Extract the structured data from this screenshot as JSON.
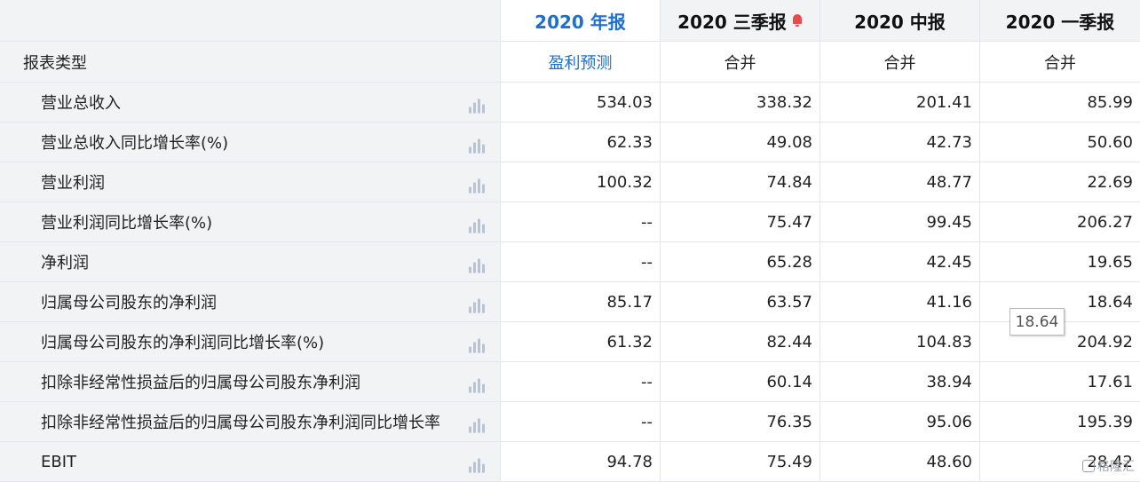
{
  "columns": [
    {
      "label": "2020 年报",
      "active": true
    },
    {
      "label": "2020 三季报",
      "bell": true
    },
    {
      "label": "2020 中报"
    },
    {
      "label": "2020 一季报"
    }
  ],
  "report_type": {
    "label": "报表类型",
    "values": [
      "盈利预测",
      "合并",
      "合并",
      "合并"
    ]
  },
  "rows": [
    {
      "label": "营业总收入",
      "values": [
        "534.03",
        "338.32",
        "201.41",
        "85.99"
      ]
    },
    {
      "label": "营业总收入同比增长率(%)",
      "values": [
        "62.33",
        "49.08",
        "42.73",
        "50.60"
      ]
    },
    {
      "label": "营业利润",
      "values": [
        "100.32",
        "74.84",
        "48.77",
        "22.69"
      ]
    },
    {
      "label": "营业利润同比增长率(%)",
      "values": [
        "--",
        "75.47",
        "99.45",
        "206.27"
      ]
    },
    {
      "label": "净利润",
      "values": [
        "--",
        "65.28",
        "42.45",
        "19.65"
      ]
    },
    {
      "label": "归属母公司股东的净利润",
      "values": [
        "85.17",
        "63.57",
        "41.16",
        "18.64"
      ]
    },
    {
      "label": "归属母公司股东的净利润同比增长率(%)",
      "values": [
        "61.32",
        "82.44",
        "104.83",
        "204.92"
      ]
    },
    {
      "label": "扣除非经常性损益后的归属母公司股东净利润",
      "values": [
        "--",
        "60.14",
        "38.94",
        "17.61"
      ]
    },
    {
      "label": "扣除非经常性损益后的归属母公司股东净利润同比增长率",
      "values": [
        "--",
        "76.35",
        "95.06",
        "195.39"
      ]
    },
    {
      "label": "EBIT",
      "values": [
        "94.78",
        "75.49",
        "48.60",
        "28.42"
      ]
    }
  ],
  "tooltip": {
    "text": "18.64"
  },
  "watermark": {
    "text": "格隆汇"
  },
  "colors": {
    "accent": "#1f6fd0",
    "header_bg": "#f2f3f5",
    "bell": "#e84b4b"
  },
  "icons": {
    "row_chart": "bar-chart-icon",
    "alert": "bell-icon"
  }
}
